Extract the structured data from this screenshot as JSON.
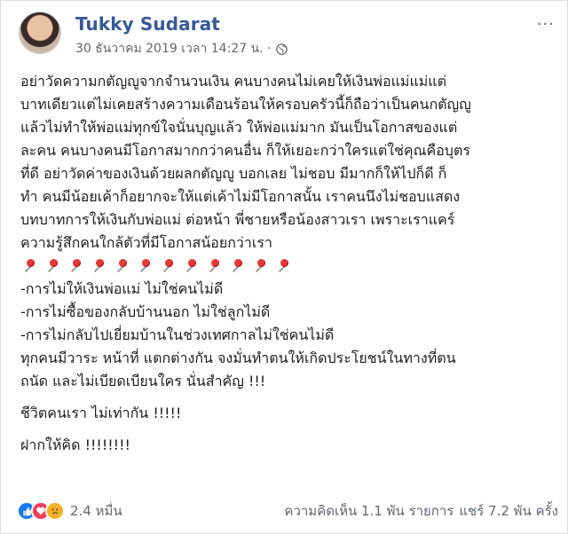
{
  "post": {
    "author": "Tukky Sudarat",
    "timestamp": "30 ธันวาคม 2019 เวลา 14:27 น. ·",
    "privacy_icon": "globe-icon",
    "body_lines": [
      "อย่าวัดความกตัญญูจากจำนวนเงิน คนบางคนไม่เคยให้เงินพ่อแม่แม่แต่",
      "บาทเดียวแต่ไม่เคยสร้างความเดือนร้อนให้ครอบครัวนี้ก็ถือว่าเป็นคนกตัญญู",
      "แล้วไม่ทำให้พ่อแม่ทุกข์ใจนั่นบุญแล้ว ให้พ่อแม่มาก มันเป็นโอกาสของแต่",
      "ละคน คนบางคนมีโอกาสมากกว่าคนอื่น ก็ให้เยอะกว่าใครแต่ใช่คุณคือบุตร",
      "ที่ดี อย่าวัดค่าของเงินด้วยผลกตัญญู บอกเลย ไม่ชอบ มีมากก็ให้ไปก็ดี ก็",
      "ทำ คนมีน้อยเค้าก็อยากจะให้แต่เค้าไม่มีโอกาสนั้น เราคนนึงไม่ชอบแสดง",
      "บทบาทการให้เงินกับพ่อแม่ ต่อหน้า พี่ชายหรือน้องสาวเรา เพราะเราแคร์",
      "ความรู้สึกคนใกล้ตัวที่มีโอกาสน้อยกว่าเรา"
    ],
    "list_lines": [
      "-การไม่ให้เงินพ่อแม่ ไม่ใช่คนไม่ดี",
      "-การไม่ซื้อของกลับบ้านนอก ไม่ใช่ลูกไม่ดี",
      "-การไม่กลับไปเยี่ยมบ้านในช่วงเทศกาลไม่ใช่คนไม่ดี",
      "ทุกคนมีวาระ หน้าที่ แตกต่างกัน จงมั่นทำตนให้เกิดประโยชน์ในทางที่ตน",
      "ถนัด และไม่เบียดเบียนใคร นั่นสำคัญ !!!"
    ],
    "line_life": "ชีวิตคนเรา ไม่เท่ากัน !!!!!",
    "line_closing": "ฝากให้คิด !!!!!!!!",
    "pin_count": 12
  },
  "footer": {
    "reaction_count": "2.4 หมื่น",
    "comments": "ความคิดเห็น 1.1 พัน รายการ",
    "shares": "แชร์ 7.2 พัน ครั้ง"
  }
}
